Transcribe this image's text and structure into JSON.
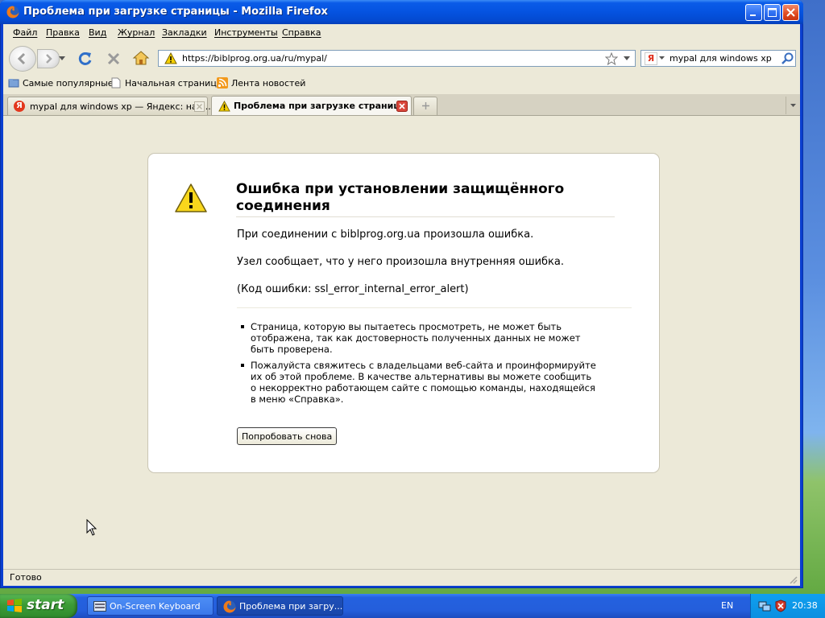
{
  "window": {
    "title": "Проблема при загрузке страницы - Mozilla Firefox"
  },
  "menu": [
    "Файл",
    "Правка",
    "Вид",
    "Журнал",
    "Закладки",
    "Инструменты",
    "Справка"
  ],
  "nav": {
    "url": "https://biblprog.org.ua/ru/mypal/",
    "search_value": "mypal для windows xp"
  },
  "bookmarks": [
    "Самые популярные",
    "Начальная страница",
    "Лента новостей"
  ],
  "tabs": [
    {
      "label": "mypal для windows xp — Яндекс: наш...",
      "active": false
    },
    {
      "label": "Проблема при загрузке страницы",
      "active": true
    }
  ],
  "error": {
    "title": "Ошибка при установлении защищённого соединения",
    "line1": "При соединении с biblprog.org.ua произошла ошибка.",
    "line2": "Узел сообщает, что у него произошла внутренняя ошибка.",
    "line3": "(Код ошибки: ssl_error_internal_error_alert)",
    "bullets": [
      "Страница, которую вы пытаетесь просмотреть, не может быть отображена, так как достоверность полученных данных не может быть проверена.",
      "Пожалуйста свяжитесь с владельцами веб-сайта и проинформируйте их об этой проблеме. В качестве альтернативы вы можете сообщить о некорректно работающем сайте с помощью команды, находящейся в меню «Справка»."
    ],
    "button": "Попробовать снова"
  },
  "status": {
    "text": "Готово"
  },
  "taskbar": {
    "start": "start",
    "items": [
      {
        "label": "On-Screen Keyboard",
        "active": false
      },
      {
        "label": "Проблема при загру...",
        "active": true
      }
    ],
    "lang": "EN",
    "clock": "20:38"
  },
  "colors": {
    "titlebar": "#0553e0",
    "chrome": "#ece9d8",
    "taskbar": "#245edb",
    "start": "#3c9b36"
  }
}
